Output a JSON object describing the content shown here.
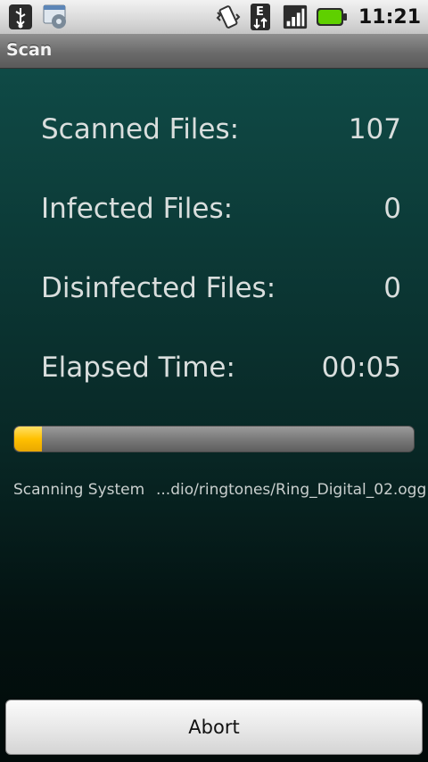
{
  "status_bar": {
    "time": "11:21",
    "icons": [
      "usb-icon",
      "settings-gear-icon",
      "vibrate-icon",
      "edge-data-icon",
      "signal-icon",
      "battery-icon"
    ],
    "network_label": "E"
  },
  "titlebar": {
    "title": "Scan"
  },
  "stats": {
    "scanned_label": "Scanned Files:",
    "scanned_value": "107",
    "infected_label": "Infected Files:",
    "infected_value": "0",
    "disinfected_label": "Disinfected Files:",
    "disinfected_value": "0",
    "elapsed_label": "Elapsed Time:",
    "elapsed_value": "00:05"
  },
  "progress": {
    "fraction": 0.07,
    "color": "#ffc000"
  },
  "scan_status": {
    "label": "Scanning System",
    "path": "...dio/ringtones/Ring_Digital_02.ogg"
  },
  "abort_button": {
    "label": "Abort"
  },
  "colors": {
    "accent": "#ffc000",
    "background": "#0c3a37"
  }
}
